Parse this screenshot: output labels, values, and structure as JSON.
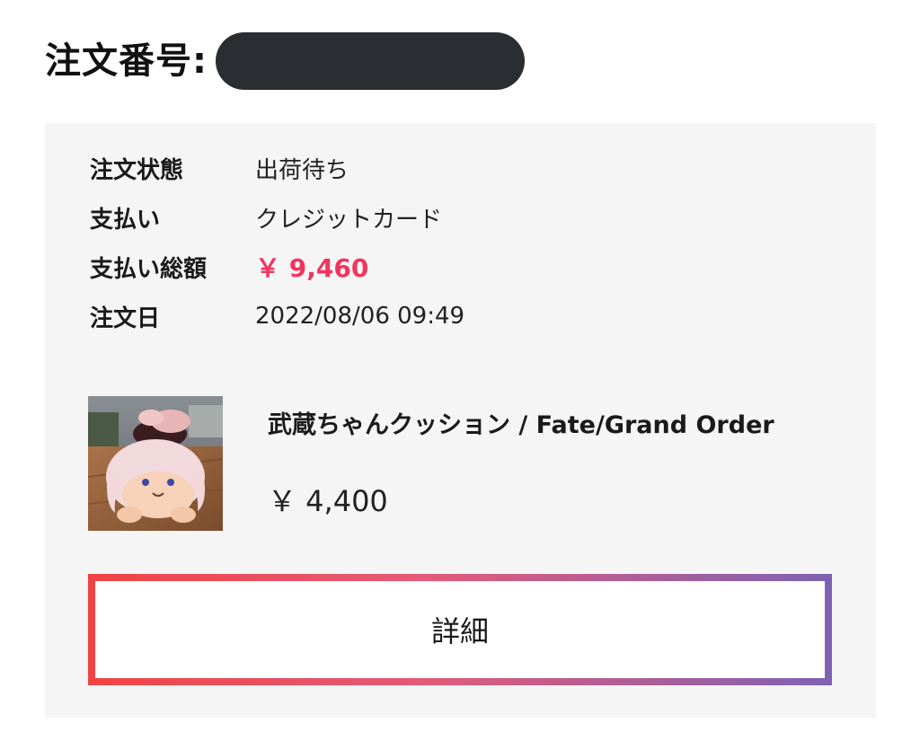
{
  "header": {
    "label": "注文番号:"
  },
  "order": {
    "rows": [
      {
        "label": "注文状態",
        "value": "出荷待ち"
      },
      {
        "label": "支払い",
        "value": "クレジットカード"
      },
      {
        "label": "支払い総額",
        "value": "￥ 9,460"
      },
      {
        "label": "注文日",
        "value": "2022/08/06 09:49"
      }
    ],
    "total_color": "#f2345e"
  },
  "product": {
    "title": "武蔵ちゃんクッション / Fate/Grand Order",
    "price": "￥ 4,400",
    "image_icon": "plush-cushion-photo"
  },
  "detail_button": {
    "label": "詳細",
    "gradient": [
      "#f04444",
      "#e45a78",
      "#7d62b2"
    ]
  }
}
